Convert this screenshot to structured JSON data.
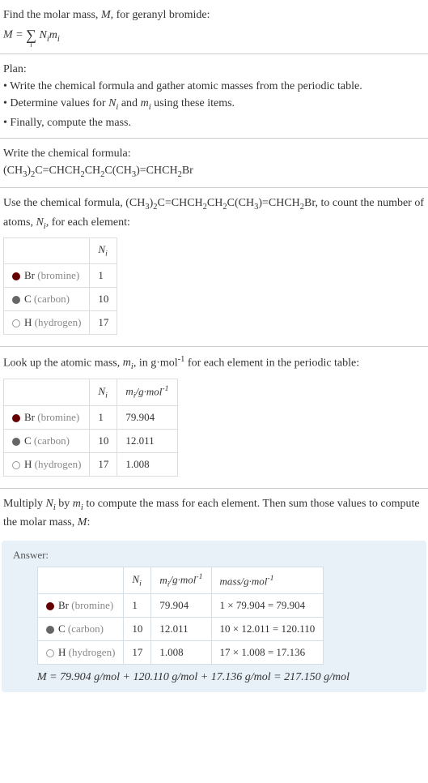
{
  "intro": {
    "line1": "Find the molar mass, M, for geranyl bromide:"
  },
  "plan": {
    "heading": "Plan:",
    "bullet1": "• Write the chemical formula and gather atomic masses from the periodic table.",
    "bullet3": "• Finally, compute the mass."
  },
  "writeFormula": {
    "heading": "Write the chemical formula:"
  },
  "countAtoms": {
    "part1": "Use the chemical formula, ",
    "part2": ", to count the number of atoms, ",
    "part3": ", for each element:"
  },
  "lookupMass": {
    "part1": "Look up the atomic mass, ",
    "part2": ", in g·mol",
    "part3": " for each element in the periodic table:"
  },
  "multiply": {
    "text": "Multiply N",
    "text2": " by m",
    "text3": " to compute the mass for each element. Then sum those values to compute the molar mass, M:"
  },
  "answer": {
    "label": "Answer:",
    "final": "M = 79.904 g/mol + 120.110 g/mol + 17.136 g/mol = 217.150 g/mol"
  },
  "elements": {
    "br": {
      "symbol": "Br",
      "name": "(bromine)"
    },
    "c": {
      "symbol": "C",
      "name": "(carbon)"
    },
    "h": {
      "symbol": "H",
      "name": "(hydrogen)"
    }
  },
  "headers": {
    "ni": "N",
    "mi_unit": "/g·mol",
    "mass_unit": "mass/g·mol"
  },
  "table1": {
    "br_n": "1",
    "c_n": "10",
    "h_n": "17"
  },
  "table2": {
    "br_m": "79.904",
    "c_m": "12.011",
    "h_m": "1.008"
  },
  "table3": {
    "br_calc": "1 × 79.904 = 79.904",
    "c_calc": "10 × 12.011 = 120.110",
    "h_calc": "17 × 1.008 = 17.136"
  }
}
